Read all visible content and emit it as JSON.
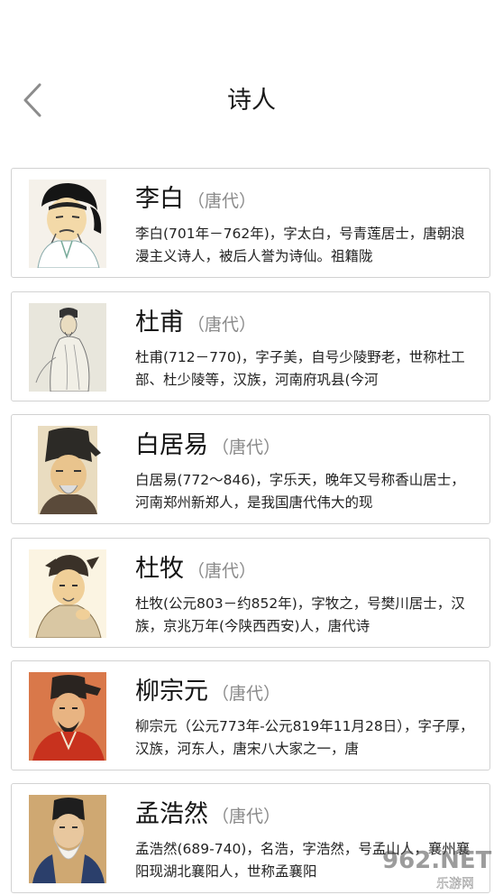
{
  "header": {
    "title": "诗人",
    "back_icon": "chevron-left-icon"
  },
  "poets": [
    {
      "name": "李白",
      "dynasty": "（唐代）",
      "bio": "李白(701年－762年)，字太白，号青莲居士，唐朝浪漫主义诗人，被后人誉为诗仙。祖籍陇"
    },
    {
      "name": "杜甫",
      "dynasty": "（唐代）",
      "bio": "杜甫(712－770)，字子美，自号少陵野老，世称杜工部、杜少陵等，汉族，河南府巩县(今河"
    },
    {
      "name": "白居易",
      "dynasty": "（唐代）",
      "bio": "白居易(772～846)，字乐天，晚年又号称香山居士，河南郑州新郑人，是我国唐代伟大的现"
    },
    {
      "name": "杜牧",
      "dynasty": "（唐代）",
      "bio": "杜牧(公元803－约852年)，字牧之，号樊川居士，汉族，京兆万年(今陕西西安)人，唐代诗"
    },
    {
      "name": "柳宗元",
      "dynasty": "（唐代）",
      "bio": "柳宗元（公元773年-公元819年11月28日），字子厚，汉族，河东人，唐宋八大家之一，唐"
    },
    {
      "name": "孟浩然",
      "dynasty": "（唐代）",
      "bio": "孟浩然(689-740)，名浩，字浩然，号孟山人，襄州襄阳现湖北襄阳人，世称孟襄阳"
    }
  ],
  "watermark": {
    "text": "962.NET",
    "subtext": "乐游网"
  },
  "colors": {
    "border": "#d2d2d2",
    "dynasty": "#8a8a8a",
    "back_arrow": "#8c8c8c"
  }
}
